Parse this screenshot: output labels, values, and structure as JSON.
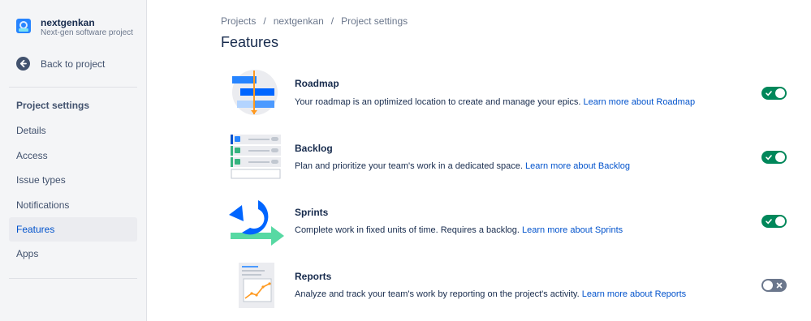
{
  "sidebar": {
    "project_name": "nextgenkan",
    "project_type": "Next-gen software project",
    "back_label": "Back to project",
    "section_title": "Project settings",
    "items": [
      {
        "label": "Details",
        "active": false
      },
      {
        "label": "Access",
        "active": false
      },
      {
        "label": "Issue types",
        "active": false
      },
      {
        "label": "Notifications",
        "active": false
      },
      {
        "label": "Features",
        "active": true
      },
      {
        "label": "Apps",
        "active": false
      }
    ]
  },
  "breadcrumb": [
    "Projects",
    "nextgenkan",
    "Project settings"
  ],
  "breadcrumb_separator": "/",
  "page_title": "Features",
  "features": [
    {
      "name": "Roadmap",
      "description": "Your roadmap is an optimized location to create and manage your epics.",
      "link": "Learn more about Roadmap",
      "enabled": true,
      "icon": "roadmap-illustration"
    },
    {
      "name": "Backlog",
      "description": "Plan and prioritize your team's work in a dedicated space.",
      "link": "Learn more about Backlog",
      "enabled": true,
      "icon": "backlog-illustration"
    },
    {
      "name": "Sprints",
      "description": "Complete work in fixed units of time. Requires a backlog.",
      "link": "Learn more about Sprints",
      "enabled": true,
      "icon": "sprints-illustration"
    },
    {
      "name": "Reports",
      "description": "Analyze and track your team's work by reporting on the project's activity.",
      "link": "Learn more about Reports",
      "enabled": false,
      "icon": "reports-illustration"
    }
  ],
  "colors": {
    "accent": "#0052cc",
    "toggle_on": "#00875a",
    "toggle_off": "#6b778c",
    "sidebar_bg": "#f4f5f7"
  }
}
